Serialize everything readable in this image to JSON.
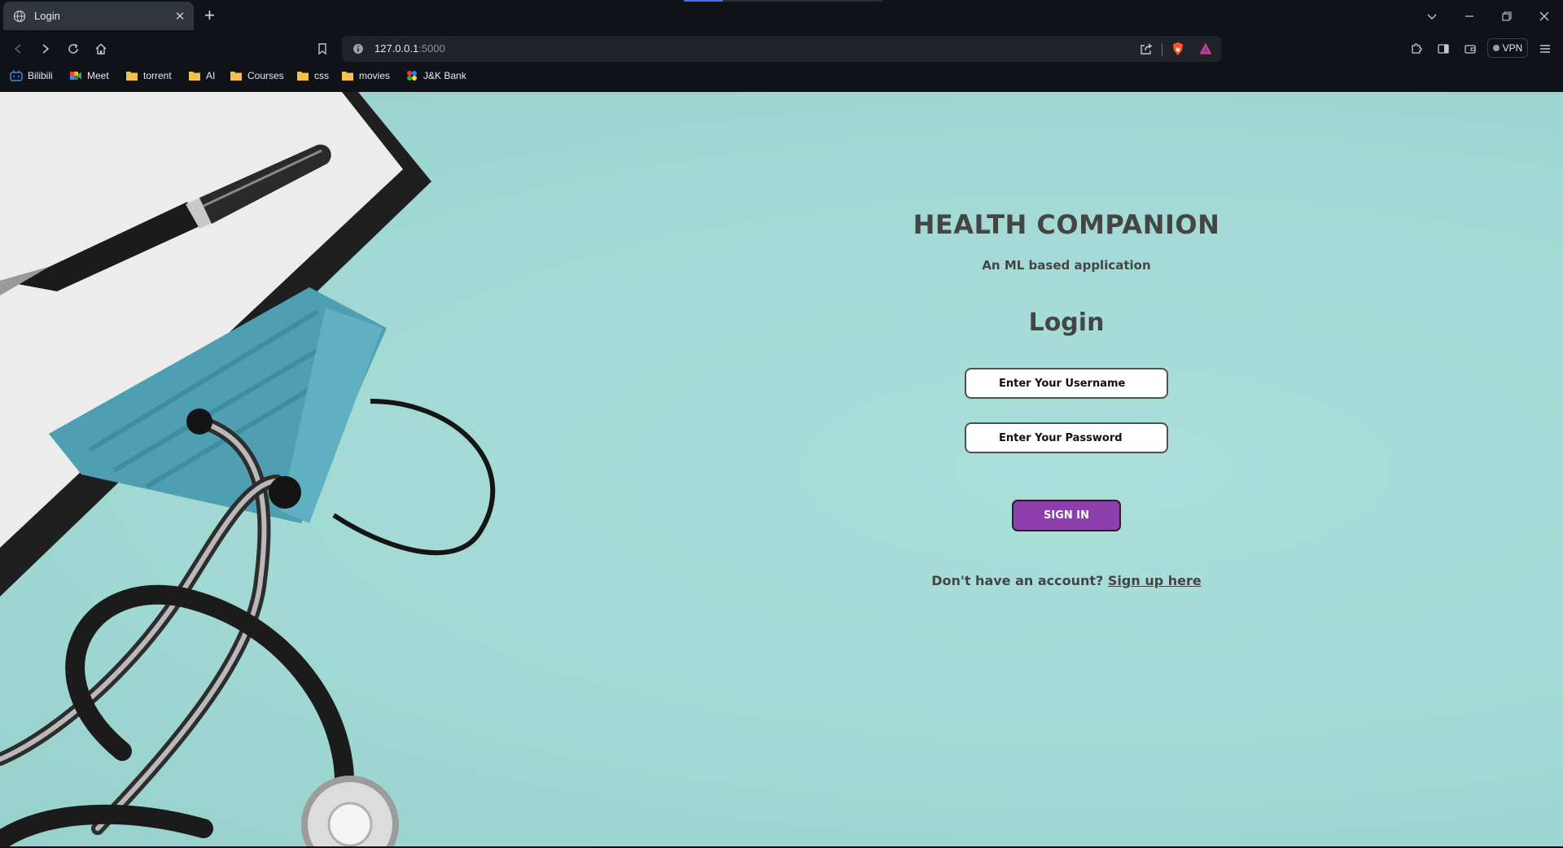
{
  "browser": {
    "tab": {
      "title": "Login"
    },
    "address_bar": {
      "host": "127.0.0.1",
      "port": ":5000"
    },
    "vpn_label": "VPN",
    "bookmarks": [
      {
        "label": "Bilibili",
        "icon": "bilibili-icon"
      },
      {
        "label": "Meet",
        "icon": "google-meet-icon"
      },
      {
        "label": "torrent",
        "icon": "folder-icon"
      },
      {
        "label": "AI",
        "icon": "folder-icon"
      },
      {
        "label": "Courses",
        "icon": "folder-icon"
      },
      {
        "label": "css",
        "icon": "folder-icon"
      },
      {
        "label": "movies",
        "icon": "folder-icon"
      },
      {
        "label": "J&K Bank",
        "icon": "jk-bank-icon"
      }
    ]
  },
  "page": {
    "brand": "HEALTH COMPANION",
    "tagline": "An ML based application",
    "heading": "Login",
    "username_placeholder": "Enter Your Username",
    "password_placeholder": "Enter Your Password",
    "signin_label": "SIGN IN",
    "signup_prompt": "Don't have an account?",
    "signup_link": "Sign up here",
    "colors": {
      "background": "#a6dcd7",
      "button": "#8e3fae",
      "text": "#454545"
    }
  }
}
